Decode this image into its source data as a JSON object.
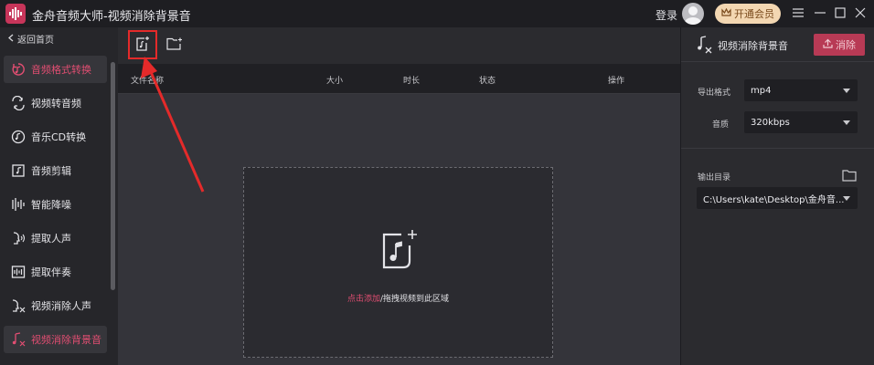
{
  "window": {
    "title": "金舟音频大师-视频消除背景音",
    "login": "登录",
    "member_button": "开通会员"
  },
  "sidebar": {
    "back": "返回首页",
    "items": [
      {
        "label": "音频格式转换",
        "icon": "audio-format-icon",
        "active": true
      },
      {
        "label": "视频转音频",
        "icon": "video-to-audio-icon",
        "active": false
      },
      {
        "label": "音乐CD转换",
        "icon": "cd-icon",
        "active": false
      },
      {
        "label": "音频剪辑",
        "icon": "audio-cut-icon",
        "active": false
      },
      {
        "label": "智能降噪",
        "icon": "denoise-icon",
        "active": false
      },
      {
        "label": "提取人声",
        "icon": "voice-extract-icon",
        "active": false
      },
      {
        "label": "提取伴奏",
        "icon": "accompaniment-icon",
        "active": false
      },
      {
        "label": "视频消除人声",
        "icon": "remove-voice-icon",
        "active": false
      },
      {
        "label": "视频消除背景音",
        "icon": "remove-bgm-icon",
        "active": true
      }
    ]
  },
  "table": {
    "columns": [
      "文件名称",
      "大小",
      "时长",
      "状态",
      "操作"
    ]
  },
  "drop_zone": {
    "accent": "点击添加",
    "rest": "/拖拽视频到此区域"
  },
  "panel": {
    "title": "视频消除背景音",
    "remove_button": "消除",
    "format_label": "导出格式",
    "format_value": "mp4",
    "quality_label": "音质",
    "quality_value": "320kbps",
    "output_label": "输出目录",
    "output_value": "C:\\Users\\kate\\Desktop\\金舟音..."
  },
  "colors": {
    "accent": "#e24e72",
    "annotation": "#e42a2a",
    "member_gold": "#f3d7b2"
  }
}
